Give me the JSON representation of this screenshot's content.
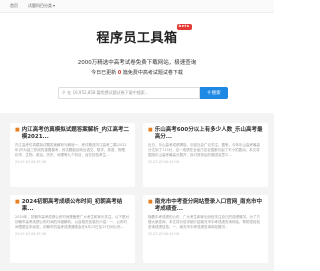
{
  "nav": {
    "home": "首页",
    "categories": "试题科目分类"
  },
  "brand": {
    "title": "程序员工具箱",
    "badge": "beta"
  },
  "hero": {
    "tagline": "2000万精选中高考试卷免费下载网站，极速查询",
    "updates_prefix": "今日已更新",
    "updates_count": "0",
    "updates_suffix": "篇免费中高考试题试卷下载"
  },
  "search": {
    "placeholder": "在 16,952,858 篇免费试题试卷下载中搜索...",
    "button_label": "搜索"
  },
  "cards": [
    {
      "title": "内江高考仿真模拟试题答案解析_内江高考二模2021...",
      "desc": "内江高考仿真模拟试题答案解析与解读一、考试概述内江高考二模(2021年)作为高三阶段的重要模考，其试题能反映出语文、数学、英语、物理、化学、生物、政治、历史、地理等九个科目，旨在检验考生...",
      "date": "25-07-03 00:43:38"
    },
    {
      "title": "乐山高考600分以上有多少人数_乐山高考最高分...",
      "desc": "近日，乐山高考成绩揭晓，引起社会广泛关注。据悉，今年乐山高考最高分达到了715分，这一成绩在全省乃至全国都引起了不小的轰动。本文将围绕乐山高考最高分展开，探讨其背后的原因及意义...",
      "date": "25-07-03 00:43:38"
    },
    {
      "title": "2024初朝高考成绩公布时间_初朝高考结果...",
      "desc": "2024年，初朝市高考成绩公布时间是备受广大考生和家长关注。以下是对初朝市高考成绩公布时间的详细解析，以及相关信息的介绍：一、公布时间根据往年经验，初朝市的高考成绩通常会在6月23日至25日间公布...",
      "date": "25-07-03 00:43:38"
    },
    {
      "title": "南充市中考查分网站登录入口官网_南充市中考成绩查...",
      "desc": "随着中考成绩的公布，广大考生和家长纷纷关注自己的成绩情况。为了方便大家查询，本文将为您详细介绍南充市中考成绩查询网站，帮助您轻松查询成绩信息。一、南充市中考成绩查询网站概况...",
      "date": "25-07-03 00:43:38"
    }
  ]
}
